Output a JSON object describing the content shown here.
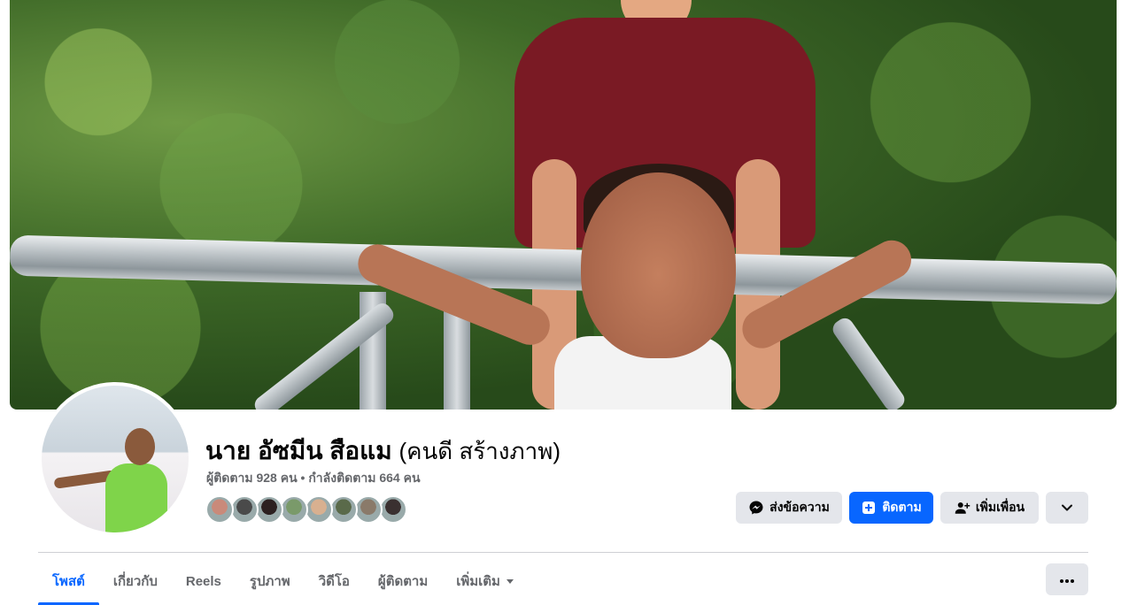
{
  "profile": {
    "name": "นาย อัซมีน สือแม",
    "alternate_name": "(คนดี สร้างภาพ)",
    "stats": "ผู้ติดตาม 928 คน • กำลังติดตาม 664 คน"
  },
  "friends_preview": {
    "colors": [
      "#c98a7a",
      "#4a4a4a",
      "#2c2020",
      "#7a9a6a",
      "#d8b090",
      "#5a6a4a",
      "#8a7a6a",
      "#3a3030"
    ]
  },
  "actions": {
    "message_label": "ส่งข้อความ",
    "follow_label": "ติดตาม",
    "add_friend_label": "เพิ่มเพื่อน"
  },
  "tabs": [
    {
      "label": "โพสต์",
      "active": true
    },
    {
      "label": "เกี่ยวกับ",
      "active": false
    },
    {
      "label": "Reels",
      "active": false
    },
    {
      "label": "รูปภาพ",
      "active": false
    },
    {
      "label": "วิดีโอ",
      "active": false
    },
    {
      "label": "ผู้ติดตาม",
      "active": false
    },
    {
      "label": "เพิ่มเติม",
      "active": false
    }
  ],
  "colors": {
    "accent": "#0866ff",
    "button_grey": "#e4e6eb",
    "secondary_text": "#65676b"
  },
  "icons": {
    "message": "messenger-icon",
    "follow": "follow-plus-icon",
    "add_friend": "add-friend-icon",
    "dropdown": "chevron-down-icon",
    "more": "ellipsis-icon",
    "tab_more": "caret-down-icon"
  }
}
